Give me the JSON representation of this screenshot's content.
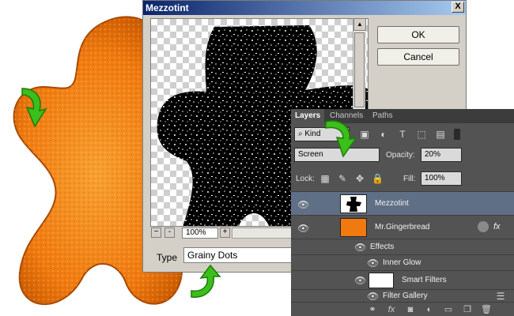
{
  "dialog": {
    "title": "Mezzotint",
    "close_label": "X",
    "ok_label": "OK",
    "cancel_label": "Cancel",
    "zoom_minus": "-",
    "zoom_plus": "+",
    "zoom_value": "100%",
    "type_label": "Type",
    "type_value": "Grainy Dots"
  },
  "layers_panel": {
    "tabs": [
      {
        "label": "Layers"
      },
      {
        "label": "Channels"
      },
      {
        "label": "Paths"
      }
    ],
    "filter_kind": "Kind",
    "blend_mode": "Screen",
    "opacity_label": "Opacity:",
    "opacity_value": "20%",
    "lock_label": "Lock:",
    "fill_label": "Fill:",
    "fill_value": "100%",
    "layers": [
      {
        "name": "Mezzotint"
      },
      {
        "name": "Mr.Gingerbread",
        "fx": "fx"
      },
      {
        "name": "Effects"
      },
      {
        "name": "Inner Glow"
      },
      {
        "name": "Smart Filters"
      },
      {
        "name": "Filter Gallery"
      }
    ],
    "bottom_fx": "fx"
  },
  "colors": {
    "gingerbread_orange": "#f07a10",
    "panel_bg": "#535353",
    "selected_row": "#5f6f85",
    "arrow_green": "#3bbf1a"
  }
}
